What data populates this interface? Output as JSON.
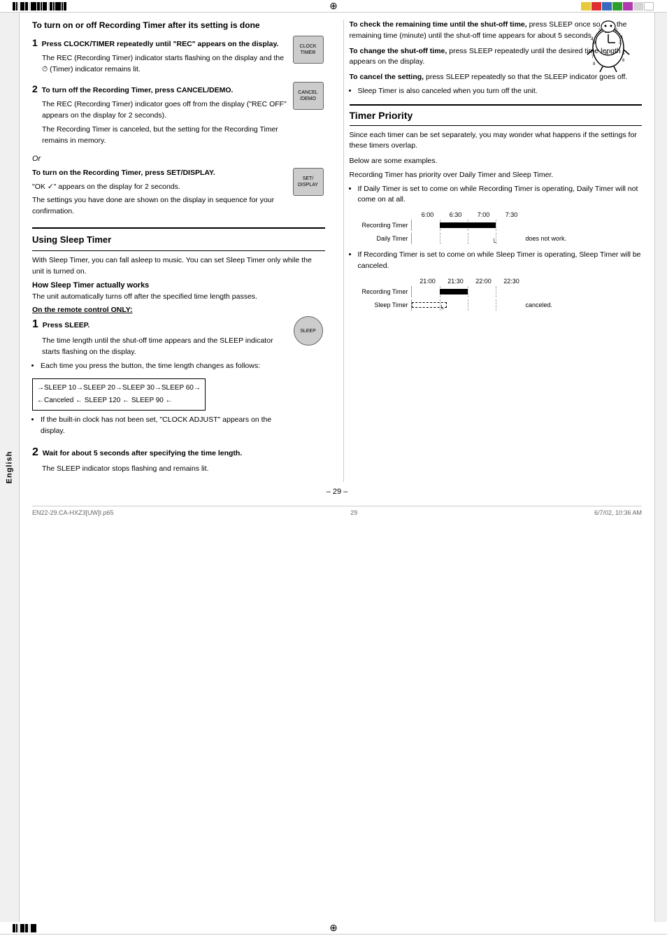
{
  "page": {
    "number": "– 29 –",
    "footer_left": "EN22-29.CA-HXZ3[UW]I.p65",
    "footer_mid": "29",
    "footer_right": "6/7/02, 10:36 AM",
    "language_label": "English"
  },
  "top_section": {
    "heading": "To turn on or off Recording Timer after its setting is done",
    "step1_num": "1",
    "step1_label": "Press CLOCK/TIMER repeatedly until \"REC\" appears on the display.",
    "step1_detail": "The REC (Recording Timer) indicator starts flashing on the display and the ⏱ (Timer) indicator remains lit.",
    "step2_num": "2",
    "step2_label": "To turn off the Recording Timer, press CANCEL/DEMO.",
    "step2_detail1": "The REC (Recording Timer) indicator goes off from the display (\"REC OFF\" appears on the display for 2 seconds).",
    "step2_detail2": "The Recording Timer is canceled, but the setting for the Recording Timer remains in memory.",
    "or_label": "Or",
    "step2b_label": "To turn on the Recording Timer, press SET/DISPLAY.",
    "step2b_detail1": "\"OK ✓\" appears on the display for 2 seconds.",
    "step2b_detail2": "The settings you have done are shown on the display in sequence for your confirmation.",
    "btn_clock": "CLOCK\nTIMER",
    "btn_cancel": "CANCEL\n/DEMO",
    "btn_set": "SET/\nDISPLAY"
  },
  "sleep_section": {
    "heading": "Using Sleep Timer",
    "intro": "With Sleep Timer, you can fall asleep to music. You can set Sleep Timer only while the unit is turned on.",
    "how_heading": "How Sleep Timer actually works",
    "how_detail": "The unit automatically turns off after the specified time length passes.",
    "remote_heading": "On the remote control ONLY:",
    "step1_num": "1",
    "step1_label": "Press SLEEP.",
    "step1_detail1": "The time length until the shut-off time appears and the SLEEP indicator starts flashing on the display.",
    "step1_bullet1": "Each time you press the button, the time length changes as follows:",
    "sleep_cycle": "→SLEEP 10→SLEEP 20→SLEEP 30→SLEEP 60→\n←Canceled ← SLEEP 120 ← SLEEP 90 ←",
    "step1_bullet2": "If the built-in clock has not been set, \"CLOCK ADJUST\" appears on the display.",
    "step2_num": "2",
    "step2_label": "Wait for about 5 seconds after specifying the time length.",
    "step2_detail": "The SLEEP indicator stops flashing and remains lit.",
    "btn_sleep": "SLEEP"
  },
  "right_col": {
    "check_remaining": "To check the remaining time until the shut-off time,",
    "check_remaining_detail": "press SLEEP once so that the remaining time (minute) until the shut-off time appears for about 5 seconds.",
    "change_shutoff": "To change the shut-off time,",
    "change_shutoff_detail": "press SLEEP repeatedly until the desired time length appears on the display.",
    "cancel_setting": "To cancel the setting,",
    "cancel_setting_detail": "press SLEEP repeatedly so that the SLEEP indicator goes off.",
    "cancel_bullet": "Sleep Timer is also canceled when you turn off the unit.",
    "timer_priority_heading": "Timer Priority",
    "timer_priority_intro": "Since each timer can be set separately, you may wonder what happens if the settings for these timers overlap.",
    "below_examples": "Below are some examples.",
    "priority_note1": "Recording Timer has priority over Daily Timer and Sleep Timer.",
    "priority_bullet1": "If Daily Timer is set to come on while Recording Timer is operating, Daily Timer will not come on at all.",
    "chart1_times": [
      "6:00",
      "6:30",
      "7:00",
      "7:30"
    ],
    "chart1_row1_label": "Recording Timer",
    "chart1_row2_label": "Daily Timer",
    "chart1_note": "does not work.",
    "priority_bullet2": "If Recording Timer is set to come on while Sleep Timer is operating, Sleep Timer will be canceled.",
    "chart2_times": [
      "21:00",
      "21:30",
      "22:00",
      "22:30"
    ],
    "chart2_row1_label": "Recording Timer",
    "chart2_row2_label": "Sleep Timer",
    "chart2_note": "canceled."
  }
}
